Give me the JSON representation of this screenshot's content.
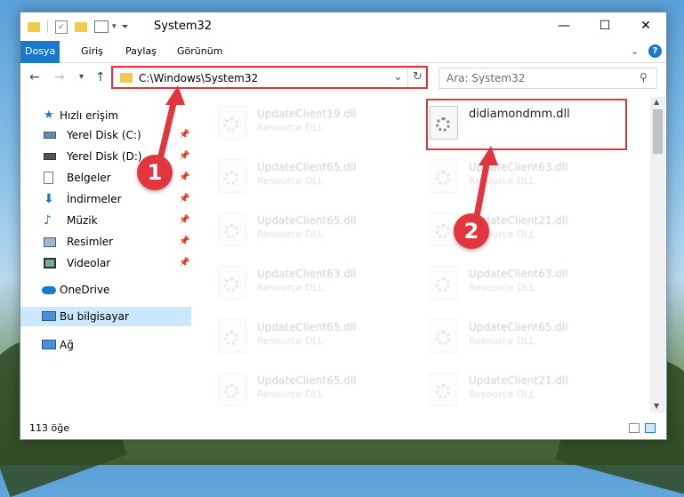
{
  "window": {
    "title": "System32",
    "controls": {
      "minimize": "—",
      "maximize": "☐",
      "close": "✕"
    }
  },
  "ribbon": {
    "tabs": [
      "Dosya",
      "Giriş",
      "Paylaş",
      "Görünüm"
    ],
    "help": "?"
  },
  "navigation": {
    "back": "←",
    "forward": "→",
    "recent": "▾",
    "up": "↑",
    "address": "C:\\Windows\\System32",
    "dropdown": "⌄",
    "refresh": "↻",
    "search_placeholder": "Ara: System32"
  },
  "sidebar": {
    "items": [
      {
        "label": "Hızlı erişim",
        "icon": "star-icon",
        "pinned": false
      },
      {
        "label": "Yerel Disk (C:)",
        "icon": "drive-icon",
        "pinned": true
      },
      {
        "label": "Yerel Disk (D:)",
        "icon": "drive-icon",
        "pinned": true
      },
      {
        "label": "Belgeler",
        "icon": "documents-icon",
        "pinned": true
      },
      {
        "label": "İndirmeler",
        "icon": "download-icon",
        "pinned": true
      },
      {
        "label": "Müzik",
        "icon": "music-icon",
        "pinned": true
      },
      {
        "label": "Resimler",
        "icon": "pictures-icon",
        "pinned": true
      },
      {
        "label": "Videolar",
        "icon": "videos-icon",
        "pinned": true
      },
      {
        "label": "OneDrive",
        "icon": "cloud-icon",
        "pinned": false
      },
      {
        "label": "Bu bilgisayar",
        "icon": "computer-icon",
        "pinned": false
      },
      {
        "label": "Ağ",
        "icon": "network-icon",
        "pinned": false
      }
    ],
    "pin_glyph": "📌"
  },
  "files": {
    "highlighted": {
      "name": "didiamondmm.dll",
      "type": ""
    },
    "left_column": [
      {
        "name": "UpdateClient19.dll",
        "type": "Resource DLL"
      },
      {
        "name": "UpdateClient65.dll",
        "type": "Resource DLL"
      },
      {
        "name": "UpdateClient65.dll",
        "type": "Resource DLL"
      },
      {
        "name": "UpdateClient63.dll",
        "type": "Resource DLL"
      },
      {
        "name": "UpdateClient65.dll",
        "type": "Resource DLL"
      },
      {
        "name": "UpdateClient65.dll",
        "type": "Resource DLL"
      }
    ],
    "right_column": [
      {
        "name": "UpdateClient63.dll",
        "type": "Resource DLL"
      },
      {
        "name": "UpdateClient21.dll",
        "type": "Resource DLL"
      },
      {
        "name": "UpdateClient63.dll",
        "type": "Resource DLL"
      },
      {
        "name": "UpdateClient65.dll",
        "type": "Resource DLL"
      },
      {
        "name": "UpdateClient21.dll",
        "type": "Resource DLL"
      }
    ]
  },
  "status": {
    "item_count": "113 öğe"
  },
  "callouts": {
    "one": "1",
    "two": "2"
  },
  "colors": {
    "accent": "#1979ca",
    "highlight": "#e2363f",
    "selected": "#cce8ff"
  }
}
